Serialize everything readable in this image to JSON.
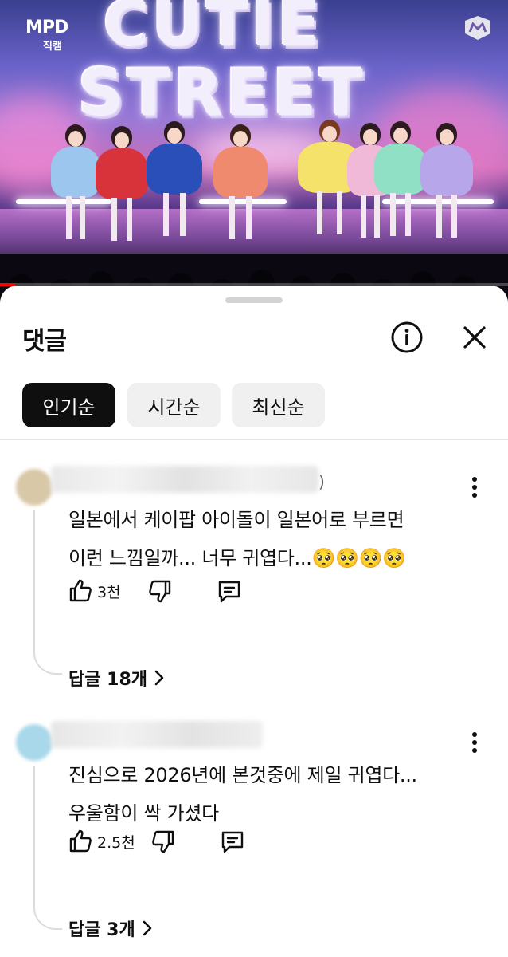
{
  "video": {
    "title_line1": "CUTIE",
    "title_line2": "STREET",
    "channel_logo_main": "MPD",
    "channel_logo_sub": "직캠",
    "corner_logo_icon": "m2-logo-icon",
    "progress_fraction": 0.03,
    "progress_color": "#ff0000"
  },
  "sheet": {
    "title": "댓글",
    "info_icon": "info-icon",
    "close_icon": "close-icon",
    "filters": [
      {
        "label": "인기순",
        "active": true
      },
      {
        "label": "시간순",
        "active": false
      },
      {
        "label": "최신순",
        "active": false
      }
    ]
  },
  "comments": [
    {
      "author_visible_tail": ")",
      "text_line1": "일본에서 케이팝 아이돌이 일본어로 부르면",
      "text_line2": "이런 느낌일까... 너무 귀엽다...🥺🥺🥺🥺",
      "like_count": "3천",
      "replies_label": "답글 18개"
    },
    {
      "author_visible_tail": "",
      "text_line1": "진심으로 2026년에 본것중에 제일 귀엽다...",
      "text_line2": "우울함이 싹 가셨다",
      "like_count": "2.5천",
      "replies_label": "답글 3개"
    }
  ],
  "icons": {
    "like": "thumbs-up-icon",
    "dislike": "thumbs-down-icon",
    "reply": "reply-comment-icon",
    "more": "more-vertical-icon",
    "chevron": "chevron-right-icon"
  },
  "colors": {
    "text_primary": "#0f0f0f",
    "chip_active_bg": "#0f0f0f",
    "chip_inactive_bg": "#f0f0f0",
    "secondary_text": "#606060"
  }
}
